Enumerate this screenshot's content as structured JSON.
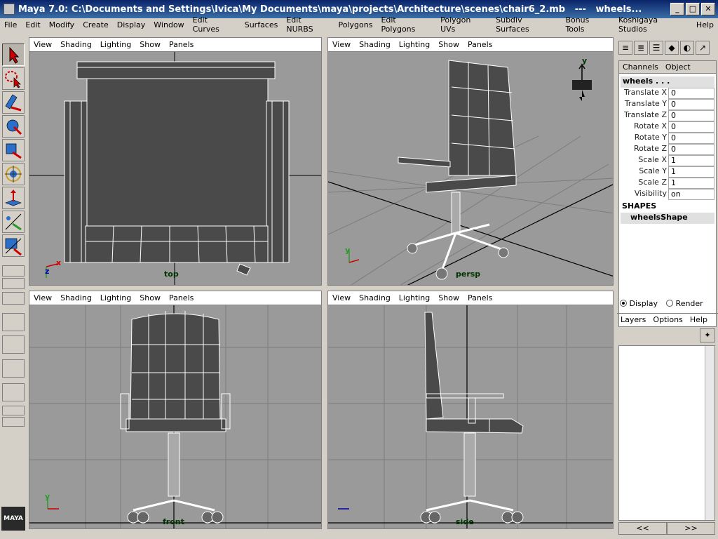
{
  "window": {
    "title": "Maya 7.0: C:\\Documents and Settings\\Ivica\\My Documents\\maya\\projects\\Architecture\\scenes\\chair6_2.mb   ---   wheels...",
    "minimize": "_",
    "maximize": "□",
    "close": "✕"
  },
  "menubar": [
    "File",
    "Edit",
    "Modify",
    "Create",
    "Display",
    "Window",
    "Edit Curves",
    "Surfaces",
    "Edit NURBS",
    "Polygons",
    "Edit Polygons",
    "Polygon UVs",
    "Subdiv Surfaces",
    "Bonus Tools",
    "Koshigaya Studios",
    "Help"
  ],
  "viewport_menu": [
    "View",
    "Shading",
    "Lighting",
    "Show",
    "Panels"
  ],
  "viewports": {
    "top": {
      "label": "top"
    },
    "persp": {
      "label": "persp"
    },
    "front": {
      "label": "front"
    },
    "side": {
      "label": "side"
    }
  },
  "axes": {
    "x": "x",
    "y": "y",
    "z": "z"
  },
  "channel_box": {
    "tabs": [
      "Channels",
      "Object"
    ],
    "object_name": "wheels . . .",
    "attributes": [
      {
        "label": "Translate X",
        "value": "0"
      },
      {
        "label": "Translate Y",
        "value": "0"
      },
      {
        "label": "Translate Z",
        "value": "0"
      },
      {
        "label": "Rotate X",
        "value": "0"
      },
      {
        "label": "Rotate Y",
        "value": "0"
      },
      {
        "label": "Rotate Z",
        "value": "0"
      },
      {
        "label": "Scale X",
        "value": "1"
      },
      {
        "label": "Scale Y",
        "value": "1"
      },
      {
        "label": "Scale Z",
        "value": "1"
      },
      {
        "label": "Visibility",
        "value": "on"
      }
    ],
    "shapes_header": "SHAPES",
    "shape_name": "wheelsShape"
  },
  "layer_editor": {
    "display_label": "Display",
    "render_label": "Render",
    "display_selected": true,
    "menu": [
      "Layers",
      "Options",
      "Help"
    ],
    "prev_button": "<<",
    "next_button": ">>"
  },
  "logo_text": "MAYA",
  "colors": {
    "viewport_bg": "#9a9a9a",
    "mesh_fill": "#4a4a4a",
    "mesh_wire": "#ffffff",
    "label_green": "#003300",
    "title_blue": "#0a246a"
  }
}
